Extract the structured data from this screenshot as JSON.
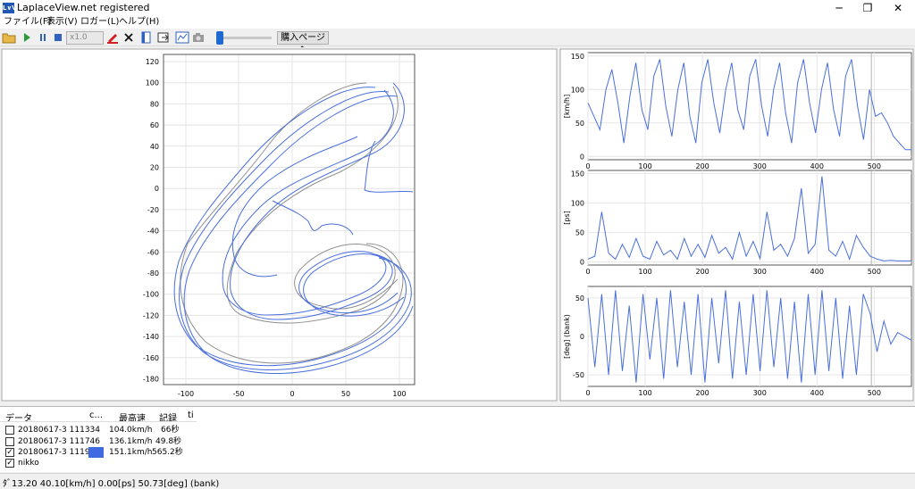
{
  "window": {
    "title": "LaplaceView.net registered",
    "app_icon_text": "L∨V",
    "minimize": "─",
    "maximize": "❐",
    "close": "✕"
  },
  "menu": [
    {
      "label": "ファイル(F)"
    },
    {
      "label": "表示(V)"
    },
    {
      "label": "ロガー(L)"
    },
    {
      "label": "ヘルプ(H)"
    }
  ],
  "toolbar": {
    "speed_value": "x1.0",
    "buy_label": "購入ページへ",
    "play_position": 0.03
  },
  "track_plot": {
    "x_ticks": [
      "-100",
      "-50",
      "0",
      "50",
      "100"
    ],
    "y_ticks": [
      "120",
      "100",
      "80",
      "60",
      "40",
      "20",
      "0",
      "-20",
      "-40",
      "-60",
      "-80",
      "-100",
      "-120",
      "-140",
      "-160",
      "-180"
    ],
    "colors": {
      "trace": "#4a6fdc",
      "ghost": "#909090"
    }
  },
  "chart_data": [
    {
      "type": "line",
      "ylabel": "[km/h]",
      "x_ticks": [
        "0",
        "100",
        "200",
        "300",
        "400",
        "500"
      ],
      "y_ticks": [
        "150",
        "100",
        "50",
        "0"
      ],
      "xlim": [
        0,
        565
      ],
      "ylim": [
        -5,
        155
      ],
      "series": [
        {
          "values": [
            80,
            60,
            40,
            100,
            130,
            80,
            20,
            90,
            140,
            70,
            40,
            120,
            145,
            75,
            30,
            100,
            140,
            60,
            20,
            110,
            145,
            80,
            35,
            100,
            140,
            70,
            40,
            120,
            145,
            75,
            30,
            100,
            140,
            65,
            20,
            110,
            145,
            80,
            35,
            100,
            140,
            70,
            30,
            120,
            145,
            75,
            25,
            100,
            60,
            65,
            50,
            30,
            20,
            10,
            10
          ]
        }
      ]
    },
    {
      "type": "line",
      "ylabel": "[ps]",
      "x_ticks": [
        "0",
        "100",
        "200",
        "300",
        "400",
        "500"
      ],
      "y_ticks": [
        "150",
        "100",
        "50",
        "0"
      ],
      "xlim": [
        0,
        565
      ],
      "ylim": [
        -5,
        155
      ],
      "series": [
        {
          "values": [
            5,
            10,
            85,
            15,
            5,
            30,
            8,
            40,
            10,
            5,
            35,
            12,
            20,
            5,
            40,
            10,
            30,
            8,
            45,
            15,
            25,
            5,
            50,
            10,
            35,
            6,
            85,
            20,
            30,
            10,
            40,
            125,
            15,
            30,
            145,
            20,
            10,
            35,
            5,
            45,
            25,
            10,
            5,
            2,
            3,
            2,
            2,
            2
          ]
        }
      ]
    },
    {
      "type": "line",
      "ylabel": "[deg] (bank)",
      "x_ticks": [
        "0",
        "100",
        "200",
        "300",
        "400",
        "500"
      ],
      "y_ticks": [
        "50",
        "0",
        "-50"
      ],
      "xlim": [
        0,
        565
      ],
      "ylim": [
        -65,
        65
      ],
      "series": [
        {
          "values": [
            50,
            -40,
            55,
            -50,
            60,
            -45,
            40,
            -60,
            55,
            -30,
            50,
            -55,
            60,
            -40,
            45,
            -50,
            55,
            -60,
            50,
            -35,
            60,
            -55,
            45,
            -50,
            55,
            -45,
            60,
            -40,
            50,
            -55,
            45,
            -60,
            55,
            -50,
            60,
            -45,
            50,
            -55,
            40,
            -50,
            55,
            30,
            -20,
            20,
            -10,
            5,
            0,
            -5
          ]
        }
      ]
    }
  ],
  "data_panel": {
    "headers": {
      "data": "データ",
      "c": "c...",
      "top_speed": "最高速",
      "record": "記録",
      "ti": "ti"
    },
    "rows": [
      {
        "name": "20180617-3 111334",
        "checked": "",
        "top_speed": "104.0km/h",
        "record": "66秒"
      },
      {
        "name": "20180617-3 111746",
        "checked": "",
        "top_speed": "136.1km/h",
        "record": "49.8秒"
      },
      {
        "name": "20180617-3 111908",
        "checked": "✓",
        "top_speed": "151.1km/h",
        "record": "565.2秒",
        "swatch": "#4169e1"
      },
      {
        "name": "nikko",
        "checked": "✓",
        "top_speed": "",
        "record": ""
      }
    ]
  },
  "status": {
    "text": "ﾀﾞ13.20 40.10[km/h]  0.00[ps]  50.73[deg] (bank)"
  }
}
